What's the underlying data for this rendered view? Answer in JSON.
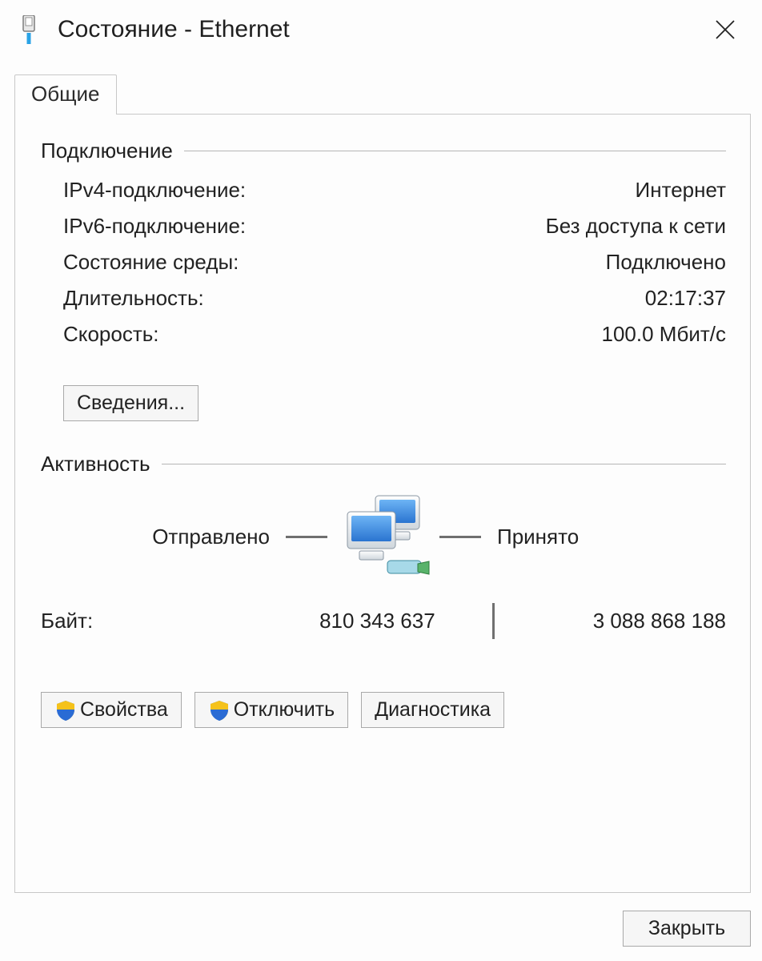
{
  "titlebar": {
    "title": "Состояние - Ethernet"
  },
  "tabs": {
    "general": "Общие"
  },
  "connection": {
    "group_label": "Подключение",
    "ipv4_label": "IPv4-подключение:",
    "ipv4_value": "Интернет",
    "ipv6_label": "IPv6-подключение:",
    "ipv6_value": "Без доступа к сети",
    "media_label": "Состояние среды:",
    "media_value": "Подключено",
    "duration_label": "Длительность:",
    "duration_value": "02:17:37",
    "speed_label": "Скорость:",
    "speed_value": "100.0 Мбит/с",
    "details_button": "Сведения..."
  },
  "activity": {
    "group_label": "Активность",
    "sent_label": "Отправлено",
    "received_label": "Принято",
    "bytes_label": "Байт:",
    "bytes_sent": "810 343 637",
    "bytes_received": "3 088 868 188"
  },
  "buttons": {
    "properties": "Свойства",
    "disable": "Отключить",
    "diagnose": "Диагностика",
    "close": "Закрыть"
  }
}
